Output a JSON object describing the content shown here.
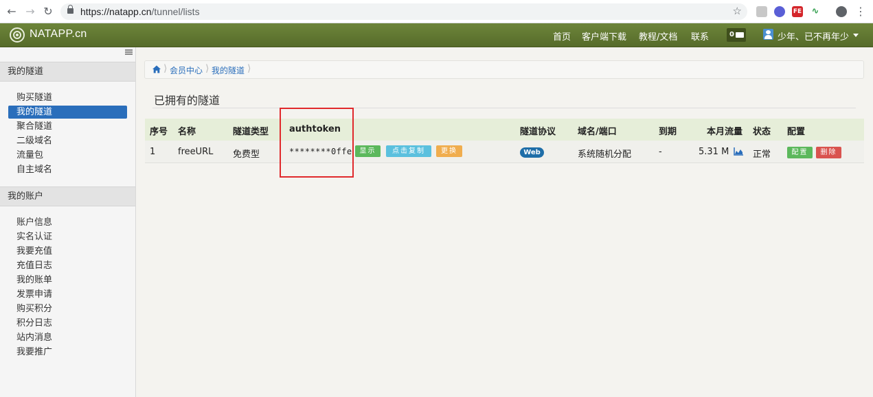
{
  "browser": {
    "url_host": "https://natapp.cn",
    "url_path": "/tunnel/lists"
  },
  "header": {
    "brand": "NATAPP.cn",
    "nav": [
      "首页",
      "客户端下载",
      "教程/文档",
      "联系"
    ],
    "message_count": "0",
    "username": "少年、已不再年少"
  },
  "sidebar": {
    "sections": [
      {
        "title": "我的隧道",
        "items": [
          {
            "label": "购买隧道",
            "active": false
          },
          {
            "label": "我的隧道",
            "active": true
          },
          {
            "label": "聚合隧道",
            "active": false
          },
          {
            "label": "二级域名",
            "active": false
          },
          {
            "label": "流量包",
            "active": false
          },
          {
            "label": "自主域名",
            "active": false
          }
        ]
      },
      {
        "title": "我的账户",
        "items": [
          {
            "label": "账户信息"
          },
          {
            "label": "实名认证"
          },
          {
            "label": "我要充值"
          },
          {
            "label": "充值日志"
          },
          {
            "label": "我的账单"
          },
          {
            "label": "发票申请"
          },
          {
            "label": "购买积分"
          },
          {
            "label": "积分日志"
          },
          {
            "label": "站内消息"
          },
          {
            "label": "我要推广"
          }
        ]
      }
    ]
  },
  "breadcrumb": [
    "会员中心",
    "我的隧道"
  ],
  "page_title": "已拥有的隧道",
  "table": {
    "headers": [
      "序号",
      "名称",
      "隧道类型",
      "authtoken",
      "隧道协议",
      "域名/端口",
      "到期",
      "本月流量",
      "状态",
      "配置"
    ],
    "rows": [
      {
        "index": "1",
        "name": "freeURL",
        "type": "免费型",
        "authtoken": "********0ffe",
        "token_buttons": [
          "显示",
          "点击复制",
          "更换"
        ],
        "protocol": "Web",
        "domain": "系统随机分配",
        "expiry": "-",
        "traffic": "5.31 M",
        "status": "正常",
        "actions": [
          "配置",
          "删除"
        ]
      }
    ]
  },
  "colors": {
    "header_green": "#5f7832",
    "active_blue": "#2a6ebb",
    "highlight_red": "#e0282b"
  }
}
